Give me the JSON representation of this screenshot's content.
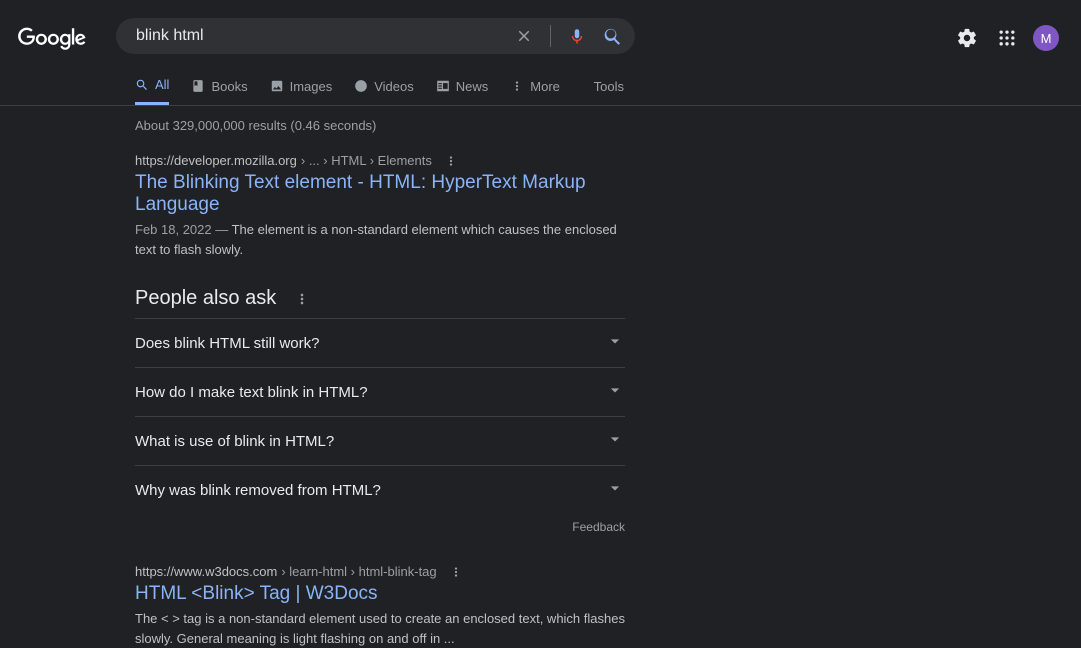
{
  "search": {
    "query": "blink html",
    "placeholder": ""
  },
  "header": {
    "avatar_initial": "M"
  },
  "tabs": {
    "all": "All",
    "books": "Books",
    "images": "Images",
    "videos": "Videos",
    "news": "News",
    "more": "More",
    "tools": "Tools"
  },
  "stats": "About 329,000,000 results (0.46 seconds)",
  "results": {
    "r1": {
      "domain": "https://developer.mozilla.org",
      "path": " › ... › HTML › Elements",
      "title": "The Blinking Text element - HTML: HyperText Markup Language",
      "date": "Feb 18, 2022 — ",
      "snippet": "The                element is a non-standard element which causes the enclosed text to flash slowly."
    },
    "r2": {
      "domain": "https://www.w3docs.com",
      "path": " › learn-html › html-blink-tag",
      "title": "HTML <Blink> Tag | W3Docs",
      "snippet": "The            <         > tag is a non-standard element used to create an enclosed text, which flashes slowly. General            meaning is light flashing on and off in ..."
    }
  },
  "paa": {
    "heading": "People also ask",
    "q1": "Does blink HTML still work?",
    "q2": "How do I make text blink in HTML?",
    "q3": "What is use of blink in HTML?",
    "q4": "Why was blink removed from HTML?",
    "feedback": "Feedback"
  }
}
